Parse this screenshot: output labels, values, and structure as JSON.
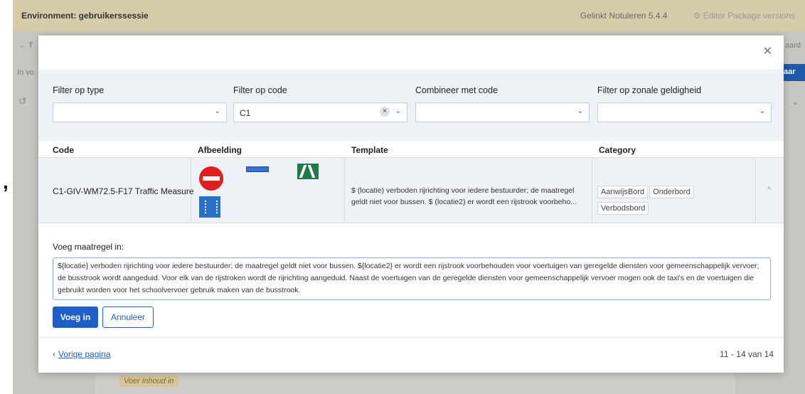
{
  "env": {
    "title": "Environment: gebruikerssessie",
    "version": "Gelinkt Notuleren 5.4.4",
    "packages": "Editor Package versions",
    "packages_icon": "gear-icon"
  },
  "background": {
    "back_prefix": "← T",
    "right_link": "aard",
    "left_text": "In vo",
    "right_button": "aar"
  },
  "modal": {
    "filters": {
      "type": {
        "label": "Filter op type",
        "value": ""
      },
      "code": {
        "label": "Filter op code",
        "value": "C1"
      },
      "combine": {
        "label": "Combineer met code",
        "value": ""
      },
      "zone": {
        "label": "Filter op zonale geldigheid",
        "value": ""
      }
    },
    "table": {
      "headers": {
        "code": "Code",
        "image": "Afbeelding",
        "template": "Template",
        "category": "Category"
      },
      "row": {
        "code": "C1-GIV-WM72.5-F17 Traffic Measure",
        "template": "$ (locatie) verboden rijrichting voor iedere bestuurder; de maatregel geldt niet voor bussen. $ (locatie2) er wordt een rijstrook voorbeho...",
        "tags": [
          "AanwijsBord",
          "Onderbord",
          "Verbodsbord"
        ]
      }
    },
    "insert": {
      "label": "Voeg maatregel in:",
      "text": "${locatie} verboden rijrichting voor iedere bestuurder; de maatregel geldt niet voor bussen. ${locatie2} er wordt een rijstrook voorbehouden voor voertuigen van geregelde diensten voor gemeenschappelijk vervoer; de busstrook wordt aangeduid. Voor elk van de rijstroken wordt de rijrichting aangeduid. Naast de voertuigen van de geregelde diensten voor gemeenschappelijk vervoer mogen ook de taxi's en de voertuigen die gebruikt worden voor het schoolvervoer gebruik maken van de busstrook.",
      "submit": "Voeg in",
      "cancel": "Annuleer"
    },
    "footer": {
      "prev": "Vorige pagina",
      "range": "11 - 14 van 14"
    }
  },
  "hint": "Voer inhoud in"
}
